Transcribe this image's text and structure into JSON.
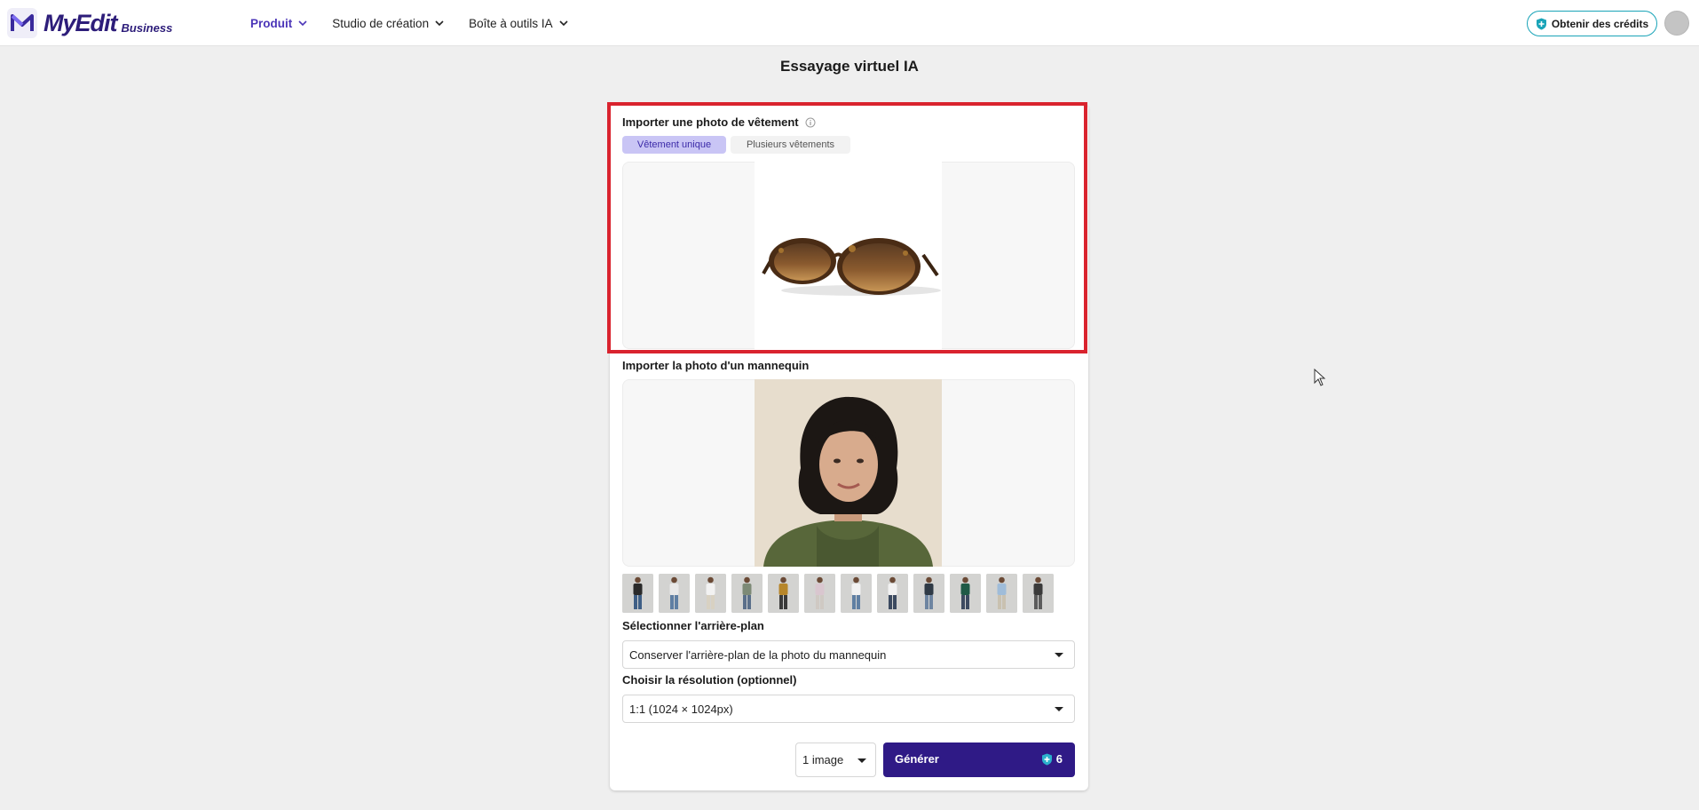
{
  "header": {
    "logo_text": "MyEdit",
    "logo_sub": "Business",
    "nav": [
      {
        "label": "Produit",
        "active": true
      },
      {
        "label": "Studio de création",
        "active": false
      },
      {
        "label": "Boîte à outils IA",
        "active": false
      }
    ],
    "credits_label": "Obtenir des crédits"
  },
  "page": {
    "title": "Essayage virtuel IA"
  },
  "garment": {
    "label": "Importer une photo de vêtement",
    "tabs": [
      {
        "label": "Vêtement unique",
        "selected": true
      },
      {
        "label": "Plusieurs vêtements",
        "selected": false
      }
    ]
  },
  "model": {
    "label": "Importer la photo d'un mannequin",
    "thumbnail_count": 12
  },
  "background": {
    "label": "Sélectionner l'arrière-plan",
    "selected": "Conserver l'arrière-plan de la photo du mannequin"
  },
  "resolution": {
    "label": "Choisir la résolution (optionnel)",
    "selected": "1:1 (1024 × 1024px)"
  },
  "actions": {
    "count_selected": "1 image",
    "generate_label": "Générer",
    "credit_cost": "6"
  },
  "colors": {
    "brand": "#2f1a86",
    "accent": "#4b35b8",
    "highlight": "#d9232e",
    "credits_border": "#1aa4b8"
  }
}
